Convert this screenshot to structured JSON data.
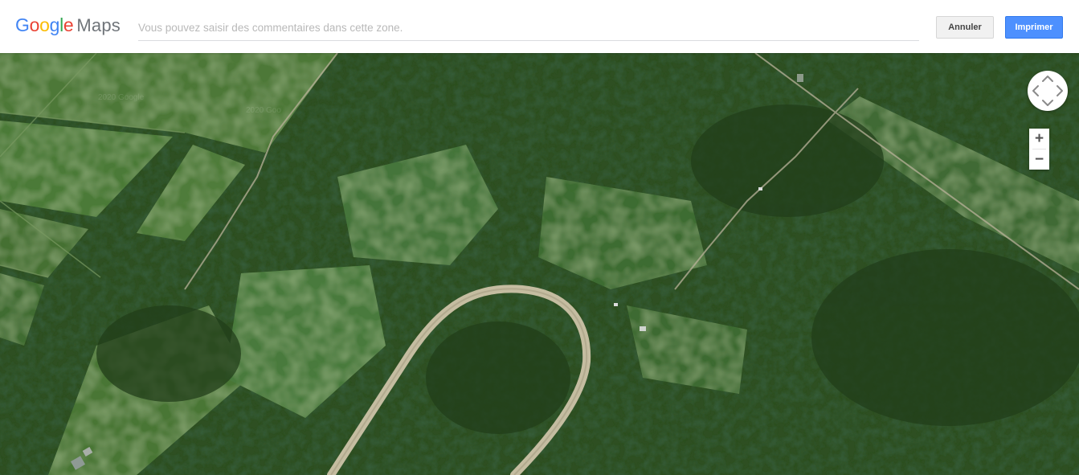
{
  "header": {
    "logo": {
      "google": "Google",
      "maps": "Maps"
    },
    "comment": {
      "placeholder": "Vous pouvez saisir des commentaires dans cette zone.",
      "value": ""
    },
    "cancel_label": "Annuler",
    "print_label": "Imprimer"
  },
  "map": {
    "view": "satellite",
    "watermark_1": "2020 Google",
    "watermark_2": "2020 Goo"
  },
  "controls": {
    "zoom_in": "+",
    "zoom_out": "−"
  },
  "colors": {
    "google_blue": "#4285F4",
    "google_red": "#EA4335",
    "google_yellow": "#FBBC05",
    "google_green": "#34A853",
    "print_button": "#4d90fe"
  }
}
